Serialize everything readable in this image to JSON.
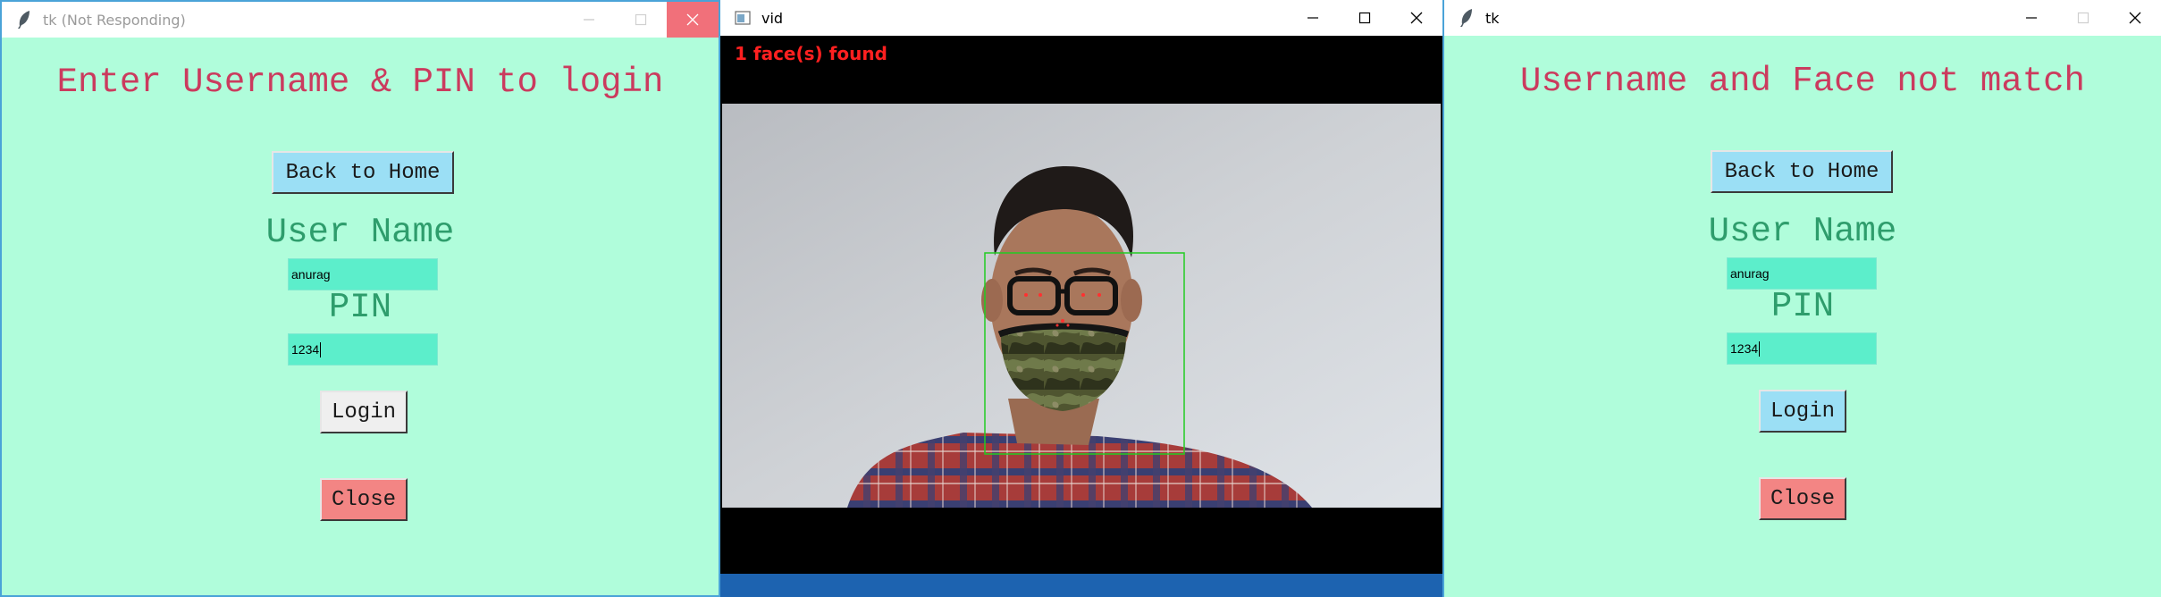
{
  "left_window": {
    "title": "tk (Not Responding)",
    "heading": "Enter Username & PIN to login",
    "back_label": "Back to Home",
    "username_label": "User Name",
    "username_value": "anurag",
    "pin_label": "PIN",
    "pin_value": "1234",
    "login_label": "Login",
    "close_label": "Close"
  },
  "video_window": {
    "title": "vid",
    "overlay_text": "1 face(s) found"
  },
  "right_window": {
    "title": "tk",
    "heading": "Username and Face not match",
    "back_label": "Back to Home",
    "username_label": "User Name",
    "username_value": "anurag",
    "pin_label": "PIN",
    "pin_value": "1234",
    "login_label": "Login",
    "close_label": "Close"
  },
  "colors": {
    "panel_bg": "#b0fddb",
    "heading": "#cb3b5e",
    "label": "#2e9d6c",
    "entry_bg": "#5ceecb",
    "button_blue": "#9bdff5",
    "button_red": "#f38584",
    "overlay_text": "#ff2020",
    "detection_box": "#22cc22"
  },
  "icons": {
    "tk_app": "feather-icon",
    "vid_app": "window-icon",
    "minimize": "minimize-icon",
    "maximize": "maximize-icon",
    "close": "close-icon"
  }
}
